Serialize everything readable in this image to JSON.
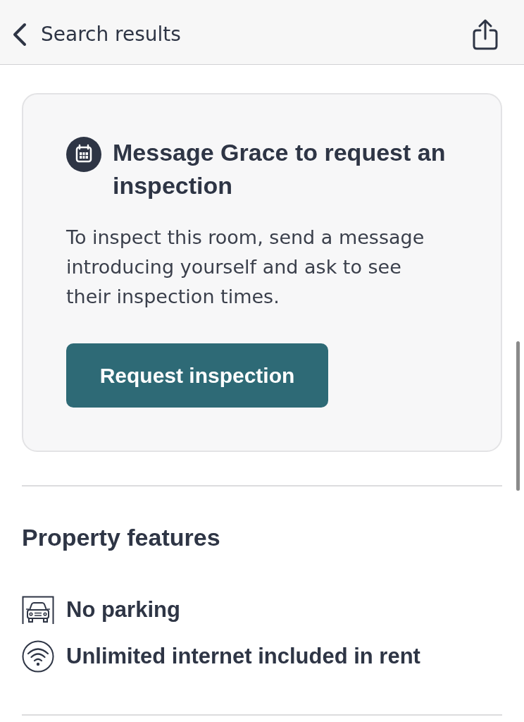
{
  "header": {
    "back_label": "Search results"
  },
  "inspection_card": {
    "title": "Message Grace to request an inspection",
    "body": "To inspect this room, send a message introducing yourself and ask to see their inspection times.",
    "button": "Request inspection"
  },
  "property_features": {
    "title": "Property features",
    "items": [
      {
        "kind": "parking",
        "label": "No parking"
      },
      {
        "kind": "internet",
        "label": "Unlimited internet included in rent"
      }
    ]
  }
}
